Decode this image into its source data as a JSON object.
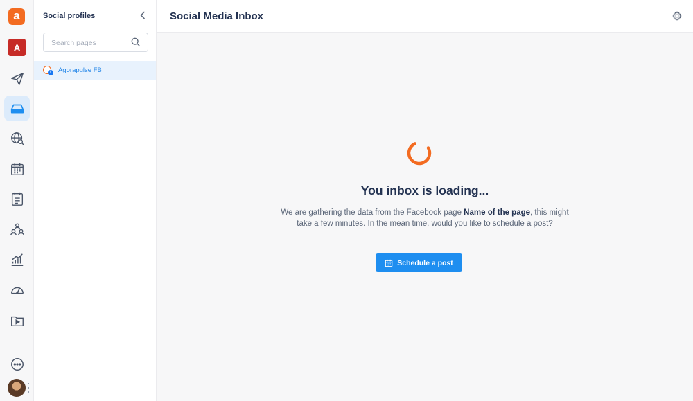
{
  "sidebar": {
    "logo_letter": "a",
    "brand_letter": "A",
    "active_index": 2,
    "icons": [
      "publish-icon",
      "inbox-icon",
      "listening-icon",
      "calendar-icon",
      "planner-icon",
      "team-icon",
      "reports-icon",
      "dashboard-icon",
      "media-library-icon",
      "more-icon"
    ]
  },
  "profiles_panel": {
    "title": "Social profiles",
    "search_placeholder": "Search pages",
    "items": [
      {
        "name": "Agorapulse FB",
        "network": "facebook",
        "badge": "f",
        "selected": true
      }
    ]
  },
  "header": {
    "title": "Social Media Inbox"
  },
  "main": {
    "loading_title": "You inbox is loading...",
    "desc_prefix": "We are gathering the data from the Facebook page ",
    "page_name": "Name of the page",
    "desc_suffix": ", this might take a few minutes. In the mean time, would you like to schedule a post?",
    "schedule_button": "Schedule a post"
  },
  "colors": {
    "accent": "#1e8ef0",
    "brand": "#f36b21",
    "spinner": "#f36b21",
    "text_dark": "#243352",
    "selected_bg": "#e8f2fd"
  }
}
